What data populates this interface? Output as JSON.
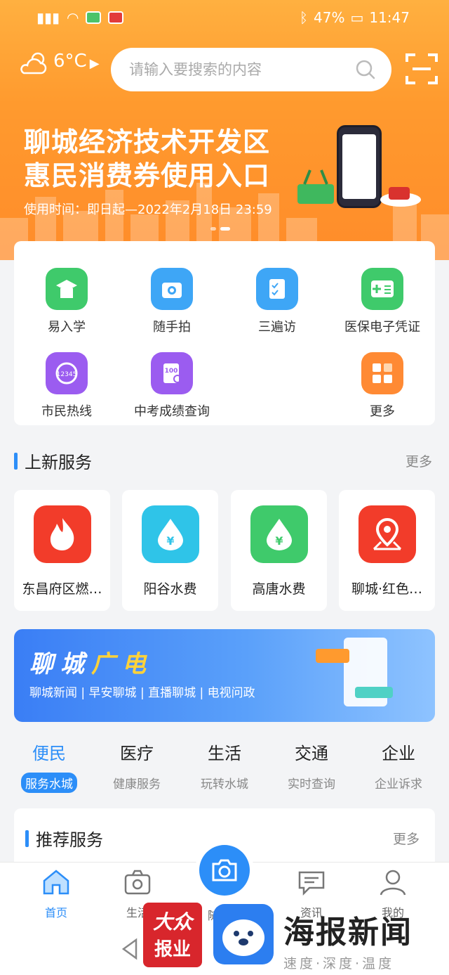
{
  "status": {
    "battery": "47%",
    "time": "11:47"
  },
  "weather": {
    "temp": "6°C",
    "sub": "--"
  },
  "search": {
    "placeholder": "请输入要搜索的内容"
  },
  "banner": {
    "line1": "聊城经济技术开发区",
    "line2": "惠民消费券使用入口",
    "time": "使用时间：即日起—2022年2月18日 23:59"
  },
  "quick_services": [
    {
      "label": "易入学",
      "icon": "school-icon",
      "color": "#3fca6b"
    },
    {
      "label": "随手拍",
      "icon": "camera-icon",
      "color": "#3ea6f6"
    },
    {
      "label": "三遍访",
      "icon": "checklist-icon",
      "color": "#3ea6f6"
    },
    {
      "label": "医保电子凭证",
      "icon": "medical-card-icon",
      "color": "#3fca6b"
    },
    {
      "label": "市民热线",
      "icon": "hotline-icon",
      "color": "#9b5cf0"
    },
    {
      "label": "中考成绩查询",
      "icon": "score-icon",
      "color": "#9b5cf0"
    },
    {
      "label": "更多",
      "icon": "grid-icon",
      "color": "#ff8a34"
    }
  ],
  "new_services": {
    "title": "上新服务",
    "more": "更多",
    "items": [
      {
        "label": "东昌府区燃…",
        "icon": "flame-icon",
        "color": "#f23c2a"
      },
      {
        "label": "阳谷水费",
        "icon": "water-drop-icon",
        "color": "#2fc4e8"
      },
      {
        "label": "高唐水费",
        "icon": "water-drop-icon",
        "color": "#3fca6b"
      },
      {
        "label": "聊城·红色…",
        "icon": "map-pin-icon",
        "color": "#f23c2a"
      }
    ]
  },
  "ad": {
    "title_a": "聊城",
    "title_b": "广电",
    "links": "聊城新闻 | 早安聊城 | 直播聊城 | 电视问政"
  },
  "categories": [
    {
      "name": "便民",
      "sub": "服务水城",
      "active": true
    },
    {
      "name": "医疗",
      "sub": "健康服务"
    },
    {
      "name": "生活",
      "sub": "玩转水城"
    },
    {
      "name": "交通",
      "sub": "实时查询"
    },
    {
      "name": "企业",
      "sub": "企业诉求"
    }
  ],
  "recommend": {
    "title": "推荐服务",
    "more": "更多"
  },
  "tabbar": [
    {
      "label": "首页",
      "icon": "home-icon",
      "active": true
    },
    {
      "label": "生活",
      "icon": "life-icon"
    },
    {
      "label": "随手拍",
      "icon": "camera-icon"
    },
    {
      "label": "资讯",
      "icon": "chat-icon"
    },
    {
      "label": "我的",
      "icon": "user-icon"
    }
  ],
  "watermark": {
    "brand1_a": "大众",
    "brand1_b": "报业",
    "brand3_a": "海报新闻",
    "brand3_b": "速度·深度·温度"
  }
}
